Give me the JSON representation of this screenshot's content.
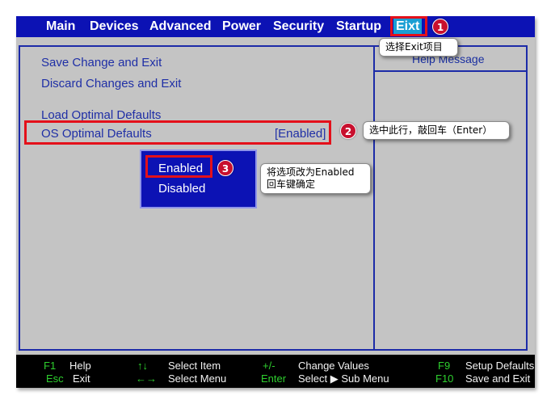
{
  "menu": {
    "items": [
      "Main",
      "Devices",
      "Advanced",
      "Power",
      "Security",
      "Startup",
      "Eixt"
    ],
    "active": "Eixt",
    "active_color": "#1a9fd4",
    "bar_color": "#0c12b4"
  },
  "help_panel": {
    "title": "Help Message"
  },
  "options": [
    {
      "label": "Save Change and Exit"
    },
    {
      "label": "Discard Changes and Exit"
    },
    {
      "label": "Load Optimal Defaults"
    },
    {
      "label": "OS Optimal Defaults",
      "value": "[Enabled]",
      "selected": true
    }
  ],
  "popup": {
    "items": [
      "Enabled",
      "Disabled"
    ],
    "highlighted": "Enabled"
  },
  "footer": {
    "keys": [
      {
        "key": "F1",
        "desc": "Help"
      },
      {
        "key": "Esc",
        "desc": "Exit"
      },
      {
        "key": "↑↓",
        "desc": "Select Item"
      },
      {
        "key": "←→",
        "desc": "Select Menu"
      },
      {
        "key": "+/-",
        "desc": "Change Values"
      },
      {
        "key": "Enter",
        "desc": "Select ▶ Sub Menu"
      },
      {
        "key": "F9",
        "desc": "Setup Defaults"
      },
      {
        "key": "F10",
        "desc": "Save and Exit"
      }
    ]
  },
  "annotations": [
    {
      "number": "1",
      "text": [
        "选择Exit项目"
      ]
    },
    {
      "number": "2",
      "text": [
        "选中此行，敲回车（Enter）"
      ]
    },
    {
      "number": "3",
      "text": [
        "将选项改为Enabled",
        "回车键确定"
      ]
    }
  ],
  "colors": {
    "highlight_border": "#e4101a",
    "badge": "#c8102e",
    "bios_bg": "#c4c4c4",
    "text_blue": "#1f2fa6"
  }
}
